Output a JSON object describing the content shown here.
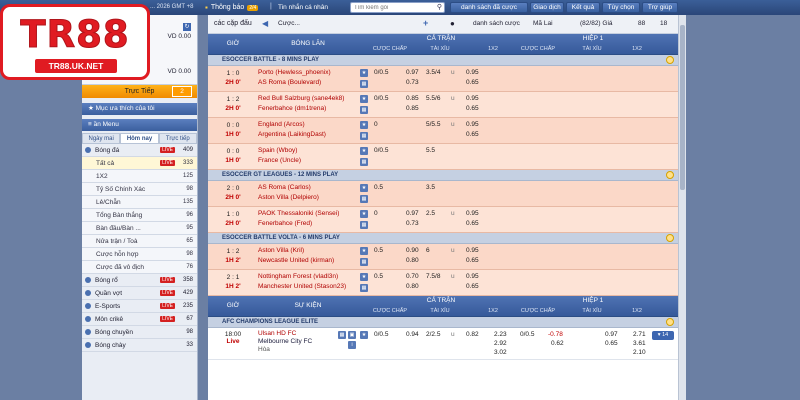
{
  "topbar": {
    "clock": "... 2026 GMT +8",
    "notice_label": "Thông báo",
    "notice_count": "2/4",
    "message_label": "Tin nhắn cá nhân",
    "search_placeholder": "Tìm kiếm gói",
    "buttons": [
      "danh sách đã cược",
      "Giao dịch",
      "Kết quả",
      "Tùy chọn",
      "Trợ giúp"
    ]
  },
  "logo": {
    "main": "TR88",
    "domain": "TR88.UK.NET"
  },
  "account": {
    "balance1": "VD 0.00",
    "balance2": "VD 0.00"
  },
  "sidebar": {
    "live_label": "Trực Tiếp",
    "live_count": "2",
    "favorites": "Mục ưa thích của tôi",
    "menu_title": "ần Menu",
    "tabs": [
      "Ngày mai",
      "Hôm nay",
      "Trực tiếp"
    ],
    "sports": [
      {
        "label": "Bóng đá",
        "live": "LIVE",
        "count": "409",
        "type": "main"
      },
      {
        "label": "Tất cả",
        "live": "LIVE",
        "count": "333",
        "type": "sub-sel"
      },
      {
        "label": "1X2",
        "live": "",
        "count": "125",
        "type": "sub"
      },
      {
        "label": "Tỷ Số Chính Xác",
        "live": "",
        "count": "98",
        "type": "sub"
      },
      {
        "label": "Lẻ/Chẵn",
        "live": "",
        "count": "135",
        "type": "sub"
      },
      {
        "label": "Tổng Bàn thắng",
        "live": "",
        "count": "96",
        "type": "sub"
      },
      {
        "label": "Bàn đầu/Bàn ...",
        "live": "",
        "count": "95",
        "type": "sub"
      },
      {
        "label": "Nửa trận / Toà",
        "live": "",
        "count": "65",
        "type": "sub"
      },
      {
        "label": "Cược hỗn hợp",
        "live": "",
        "count": "98",
        "type": "sub"
      },
      {
        "label": "Cược đã vô địch",
        "live": "",
        "count": "76",
        "type": "sub"
      },
      {
        "label": "Bóng rổ",
        "live": "LIVE",
        "count": "358",
        "type": "main"
      },
      {
        "label": "Quần vợt",
        "live": "LIVE",
        "count": "429",
        "type": "main"
      },
      {
        "label": "E-Sports",
        "live": "LIVE",
        "count": "235",
        "type": "main"
      },
      {
        "label": "Môn crikê",
        "live": "LIVE",
        "count": "67",
        "type": "main"
      },
      {
        "label": "Bóng chuyền",
        "live": "",
        "count": "98",
        "type": "main"
      },
      {
        "label": "Bóng chày",
        "live": "",
        "count": "33",
        "type": "main"
      }
    ]
  },
  "toolbar": {
    "title": "các cặp đấu",
    "dropdown": "Cược...",
    "odds_label": "danh sách cược",
    "ml": "Mã Lai",
    "price": "(82/82) Giá",
    "c1": "88",
    "c2": "18"
  },
  "header1": {
    "time": "GIỜ",
    "match": "BÓNG LĂN",
    "full": "CẢ TRẬN",
    "half": "HIỆP 1",
    "subs": [
      "CƯỢC CHẤP",
      "TÀI XỈU",
      "1X2",
      "CƯỢC CHẤP",
      "TÀI XỈU",
      "1X2"
    ]
  },
  "blocks": [
    {
      "league": "ESOCCER BATTLE - 8 MINS PLAY",
      "matches": [
        {
          "score": "1 : 0",
          "time": "2H 0'",
          "t1": "Porto (Hewless_phoenix)",
          "t2": "AS Roma (Boulevard)",
          "hdp": "0/0.5",
          "o1": "0.97",
          "ou": "3.5/4",
          "u": "u",
          "o2": "0.95",
          "o3": "0.73",
          "o4": "0.65"
        },
        {
          "score": "1 : 2",
          "time": "2H 0'",
          "t1": "Red Bull Salzburg (sane4ek8)",
          "t2": "Fenerbahce (dm1trena)",
          "hdp": "0/0.5",
          "o1": "0.85",
          "ou": "5.5/6",
          "u": "u",
          "o2": "0.95",
          "o3": "0.85",
          "o4": "0.65"
        },
        {
          "score": "0 : 0",
          "time": "1H 0'",
          "t1": "England (Arcos)",
          "t2": "Argentina (LaikingDast)",
          "hdp": "0",
          "o1": "",
          "ou": "5/5.5",
          "u": "u",
          "o2": "0.95",
          "o3": "",
          "o4": "0.65"
        },
        {
          "score": "0 : 0",
          "time": "1H 0'",
          "t1": "Spain (Wboy)",
          "t2": "France (Uncle)",
          "hdp": "0/0.5",
          "o1": "",
          "ou": "5.5",
          "u": "",
          "o2": "",
          "o3": "",
          "o4": ""
        }
      ]
    },
    {
      "league": "ESOCCER GT LEAGUES - 12 MINS PLAY",
      "matches": [
        {
          "score": "2 : 0",
          "time": "2H 0'",
          "t1": "AS Roma (Carlos)",
          "t2": "Aston Villa (Delpiero)",
          "hdp": "0.5",
          "o1": "",
          "ou": "3.5",
          "u": "",
          "o2": "",
          "o3": "",
          "o4": ""
        },
        {
          "score": "1 : 0",
          "time": "2H 0'",
          "t1": "PAOK Thessaloniki (Sensei)",
          "t2": "Fenerbahce (Fred)",
          "hdp": "0",
          "o1": "0.97",
          "ou": "2.5",
          "u": "u",
          "o2": "0.95",
          "o3": "0.73",
          "o4": "0.65"
        }
      ]
    },
    {
      "league": "ESOCCER BATTLE VOLTA - 6 MINS PLAY",
      "matches": [
        {
          "score": "1 : 2",
          "time": "1H 2'",
          "t1": "Aston Villa (Kril)",
          "t2": "Newcastle United (kirman)",
          "hdp": "0.5",
          "o1": "0.90",
          "ou": "6",
          "u": "u",
          "o2": "0.95",
          "o3": "0.80",
          "o4": "0.65"
        },
        {
          "score": "2 : 1",
          "time": "1H 2'",
          "t1": "Nottingham Forest (vladl3n)",
          "t2": "Manchester United (Stason23)",
          "hdp": "0.5",
          "o1": "0.70",
          "ou": "7.5/8",
          "u": "u",
          "o2": "0.95",
          "o3": "0.80",
          "o4": "0.65"
        }
      ]
    }
  ],
  "header2": {
    "time": "GIỜ",
    "match": "SỰ KIỆN",
    "full": "CẢ TRẬN",
    "half": "HIỆP 1",
    "subs": [
      "CƯỢC CHẤP",
      "TÀI XỈU",
      "1X2",
      "CƯỢC CHẤP",
      "TÀI XỈU",
      "1X2"
    ]
  },
  "event_league": "AFC CHAMPIONS LEAGUE ELITE",
  "event": {
    "time": "18:00",
    "live": "Live",
    "t1": "Ulsan HD FC",
    "t2": "Melbourne City FC",
    "t3": "Hòa",
    "hdp": "0/0.5",
    "o1": "0.94",
    "ou": "2/2.5",
    "o2": "0.82",
    "x1": "2.23",
    "x2": "2.92",
    "x3": "3.02",
    "hdp2": "0/0.5",
    "h1": "-0.78",
    "h2": "0.62",
    "h3": "0.97",
    "h4": "0.65",
    "h5": "2.71",
    "h6": "3.61",
    "h7": "2.10",
    "more": "14"
  }
}
